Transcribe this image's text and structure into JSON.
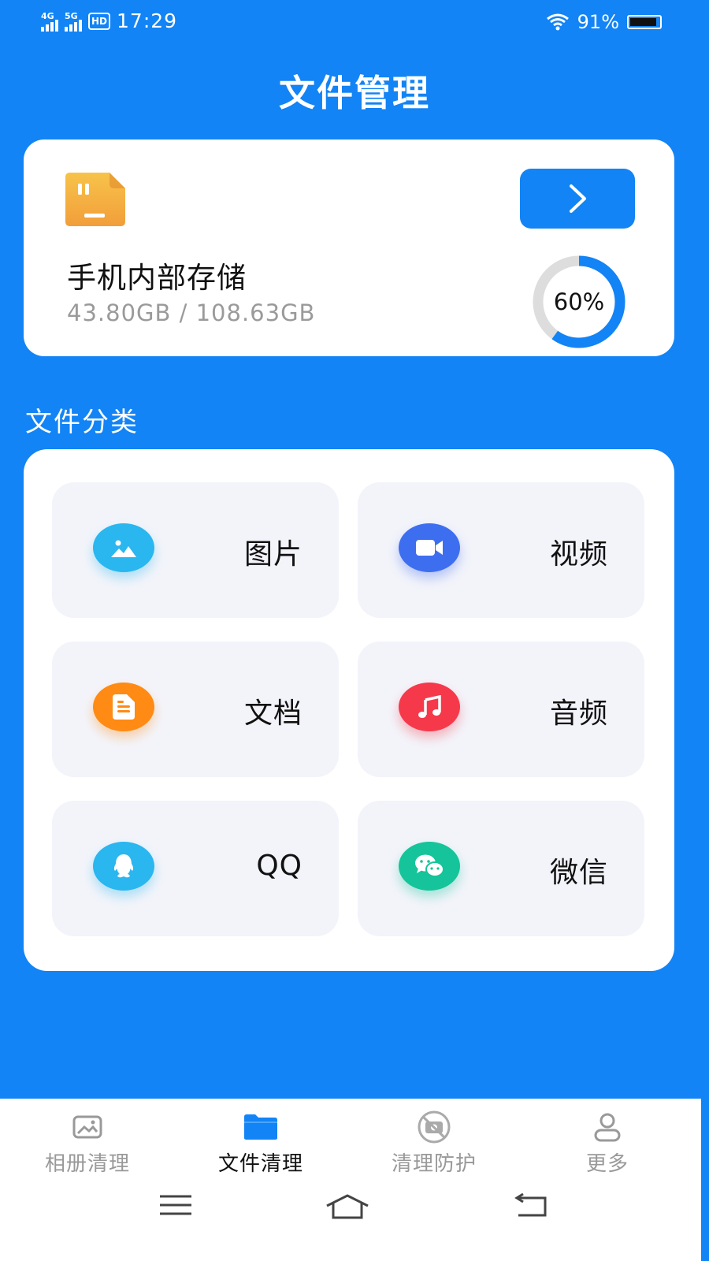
{
  "status_bar": {
    "net1": "4G",
    "net2": "5G",
    "hd": "HD",
    "time": "17:29",
    "battery": "91%",
    "battery_level": 0.91
  },
  "title": "文件管理",
  "storage": {
    "name": "手机内部存储",
    "size": "43.80GB  /  108.63GB",
    "percent_label": "60%",
    "percent": 0.6,
    "button_icon": "chevron-right-icon"
  },
  "section_title": "文件分类",
  "categories": [
    {
      "label": "图片",
      "icon": "image-icon",
      "color": "#2ab6ef"
    },
    {
      "label": "视频",
      "icon": "video-icon",
      "color": "#3e6ef0"
    },
    {
      "label": "文档",
      "icon": "document-icon",
      "color": "#ff8a14"
    },
    {
      "label": "音频",
      "icon": "music-icon",
      "color": "#f5394b"
    },
    {
      "label": "QQ",
      "icon": "qq-icon",
      "color": "#2ab6ef"
    },
    {
      "label": "微信",
      "icon": "wechat-icon",
      "color": "#15c49a"
    }
  ],
  "tabs": [
    {
      "label": "相册清理",
      "icon": "photo-icon",
      "active": false
    },
    {
      "label": "文件清理",
      "icon": "folder-icon",
      "active": true
    },
    {
      "label": "清理防护",
      "icon": "camera-off-icon",
      "active": false
    },
    {
      "label": "更多",
      "icon": "person-icon",
      "active": false
    }
  ],
  "colors": {
    "primary": "#1284f5",
    "card_bg": "#ffffff",
    "category_bg": "#f3f4fa"
  }
}
